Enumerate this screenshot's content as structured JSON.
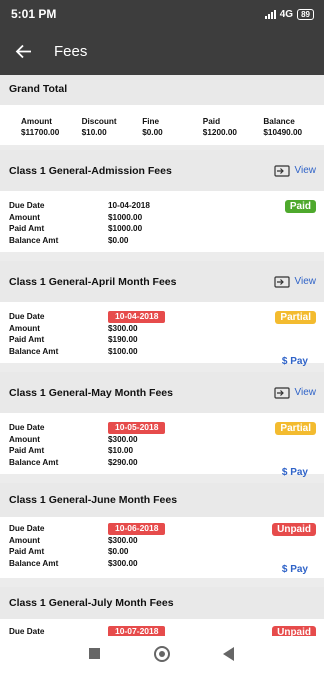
{
  "status": {
    "time": "5:01 PM",
    "network": "4G",
    "battery": "89"
  },
  "appbar": {
    "title": "Fees"
  },
  "grand_total": {
    "title": "Grand Total",
    "columns": [
      {
        "label": "Amount",
        "value": "$11700.00"
      },
      {
        "label": "Discount",
        "value": "$10.00"
      },
      {
        "label": "Fine",
        "value": "$0.00"
      },
      {
        "label": "Paid",
        "value": "$1200.00"
      },
      {
        "label": "Balance",
        "value": "$10490.00"
      }
    ]
  },
  "labels": {
    "due_date": "Due Date",
    "amount": "Amount",
    "paid_amt": "Paid Amt",
    "balance_amt": "Balance Amt",
    "view": "View",
    "pay": "$ Pay"
  },
  "fees": [
    {
      "title": "Class 1 General-Admission Fees",
      "due_date": "10-04-2018",
      "amount": "$1000.00",
      "paid_amt": "$1000.00",
      "balance_amt": "$0.00",
      "status": "Paid"
    },
    {
      "title": "Class 1 General-April Month Fees",
      "due_date": "10-04-2018",
      "amount": "$300.00",
      "paid_amt": "$190.00",
      "balance_amt": "$100.00",
      "status": "Partial"
    },
    {
      "title": "Class 1 General-May Month Fees",
      "due_date": "10-05-2018",
      "amount": "$300.00",
      "paid_amt": "$10.00",
      "balance_amt": "$290.00",
      "status": "Partial"
    },
    {
      "title": "Class 1 General-June Month Fees",
      "due_date": "10-06-2018",
      "amount": "$300.00",
      "paid_amt": "$0.00",
      "balance_amt": "$300.00",
      "status": "Unpaid"
    },
    {
      "title": "Class 1 General-July Month Fees",
      "due_date": "10-07-2018",
      "status": "Unpaid"
    }
  ]
}
